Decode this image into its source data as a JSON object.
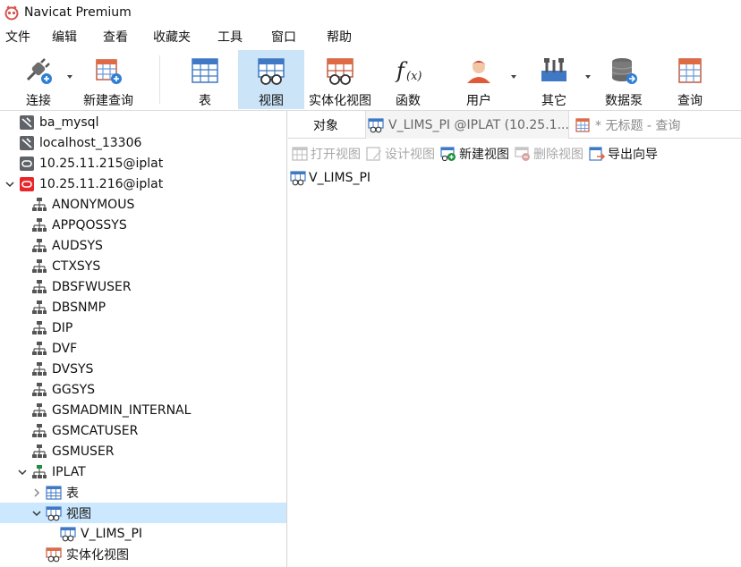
{
  "app": {
    "title": "Navicat Premium"
  },
  "menu": [
    "文件",
    "编辑",
    "查看",
    "收藏夹",
    "工具",
    "窗口",
    "帮助"
  ],
  "toolbar": {
    "connect": "连接",
    "new_query": "新建查询",
    "table": "表",
    "view": "视图",
    "materialized_view": "实体化视图",
    "function": "函数",
    "user": "用户",
    "other": "其它",
    "data_pump": "数据泵",
    "query": "查询"
  },
  "tree": {
    "connections": [
      {
        "label": "ba_mysql",
        "type": "mysql"
      },
      {
        "label": "localhost_13306",
        "type": "mysql"
      },
      {
        "label": "10.25.11.215@iplat",
        "type": "oracle-closed"
      },
      {
        "label": "10.25.11.216@iplat",
        "type": "oracle-open"
      }
    ],
    "schemas": [
      "ANONYMOUS",
      "APPQOSSYS",
      "AUDSYS",
      "CTXSYS",
      "DBSFWUSER",
      "DBSNMP",
      "DIP",
      "DVF",
      "DVSYS",
      "GGSYS",
      "GSMADMIN_INTERNAL",
      "GSMCATUSER",
      "GSMUSER"
    ],
    "open_schema": "IPLAT",
    "folder_tables": "表",
    "folder_views": "视图",
    "view_item": "V_LIMS_PI",
    "folder_mviews": "实体化视图"
  },
  "tabs": {
    "objects": "对象",
    "view_tab": "V_LIMS_PI @IPLAT (10.25.1...",
    "query_tab": "* 无标题 - 查询"
  },
  "actions": {
    "open_view": "打开视图",
    "design_view": "设计视图",
    "new_view": "新建视图",
    "delete_view": "删除视图",
    "export_wizard": "导出向导"
  },
  "objects": [
    "V_LIMS_PI"
  ],
  "colors": {
    "accent_selected": "#cce4f7",
    "tree_selected": "#cce8ff",
    "oracle_red": "#e8262a",
    "table_blue": "#3f78c4"
  }
}
